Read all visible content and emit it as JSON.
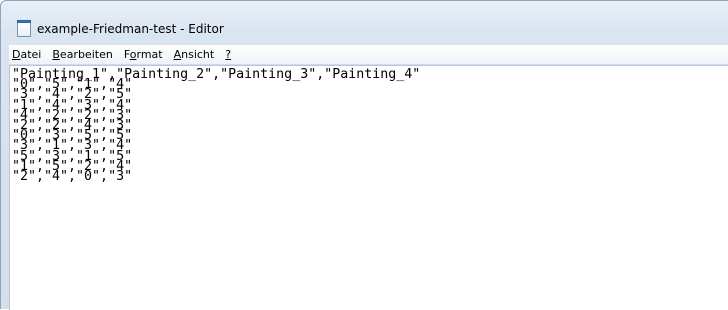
{
  "window": {
    "title": "example-Friedman-test - Editor"
  },
  "menu": {
    "items": [
      "Datei",
      "Bearbeiten",
      "Format",
      "Ansicht",
      "?"
    ]
  },
  "editor": {
    "content": "\"Painting_1\",\"Painting_2\",\"Painting_3\",\"Painting_4\"\n\"0\",\"5\",\"1\",\"4\"\n\"3\",\"4\",\"2\",\"5\"\n\"1\",\"4\",\"3\",\"4\"\n\"4\",\"2\",\"2\",\"3\"\n\"2\",\"2\",\"4\",\"3\"\n\"0\",\"3\",\"5\",\"5\"\n\"3\",\"1\",\"3\",\"4\"\n\"5\",\"3\",\"1\",\"5\"\n\"1\",\"5\",\"2\",\"4\"\n\"2\",\"4\",\"0\",\"3\""
  }
}
